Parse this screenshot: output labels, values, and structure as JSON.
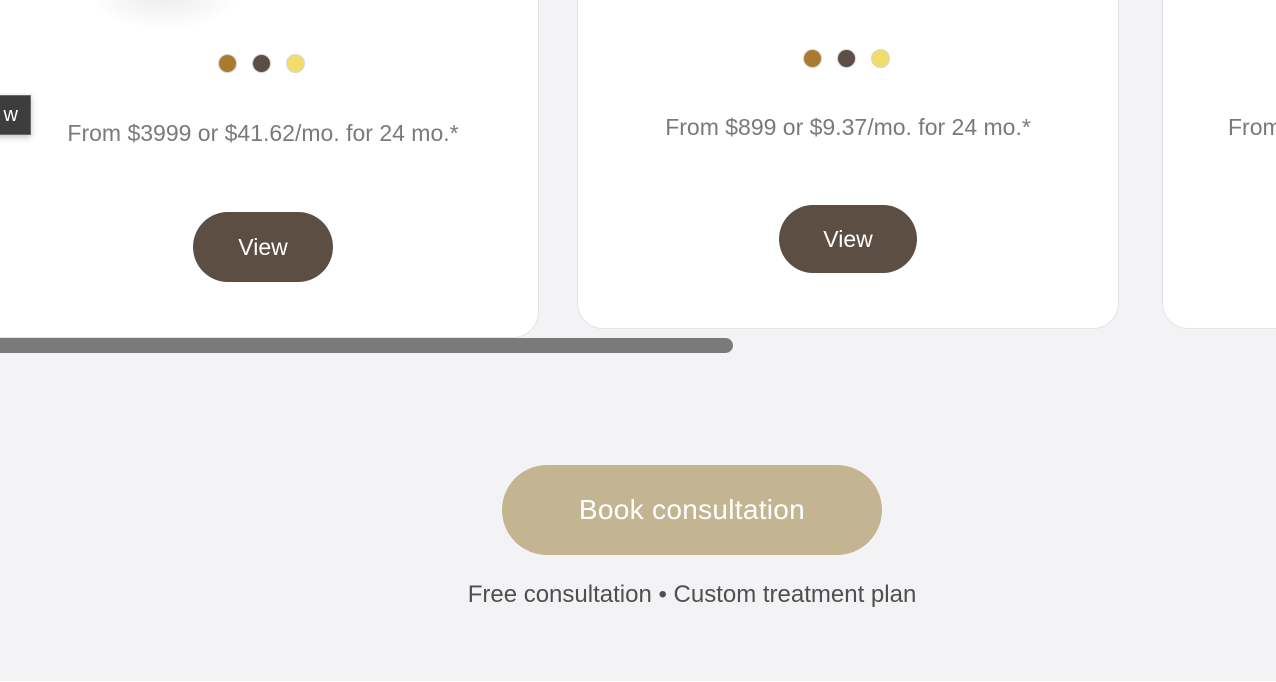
{
  "products": [
    {
      "price_text": "From $3999 or $41.62/mo. for 24 mo.*",
      "view_label": "View",
      "swatches": [
        "#a87b2f",
        "#5c4e45",
        "#f2dd6b"
      ]
    },
    {
      "price_text": "From $899 or $9.37/mo. for 24 mo.*",
      "view_label": "View",
      "swatches": [
        "#a87b2f",
        "#5c4e45",
        "#f2dd6b"
      ]
    },
    {
      "price_text": "From"
    }
  ],
  "tooltip_text": "w",
  "cta": {
    "label": "Book consultation",
    "subtext": "Free consultation • Custom treatment plan"
  },
  "colors": {
    "view_button_bg": "#5d4e44",
    "cta_bg": "#c4b592",
    "page_bg": "#f3f3f5",
    "scrollbar": "#7a7a7a"
  }
}
